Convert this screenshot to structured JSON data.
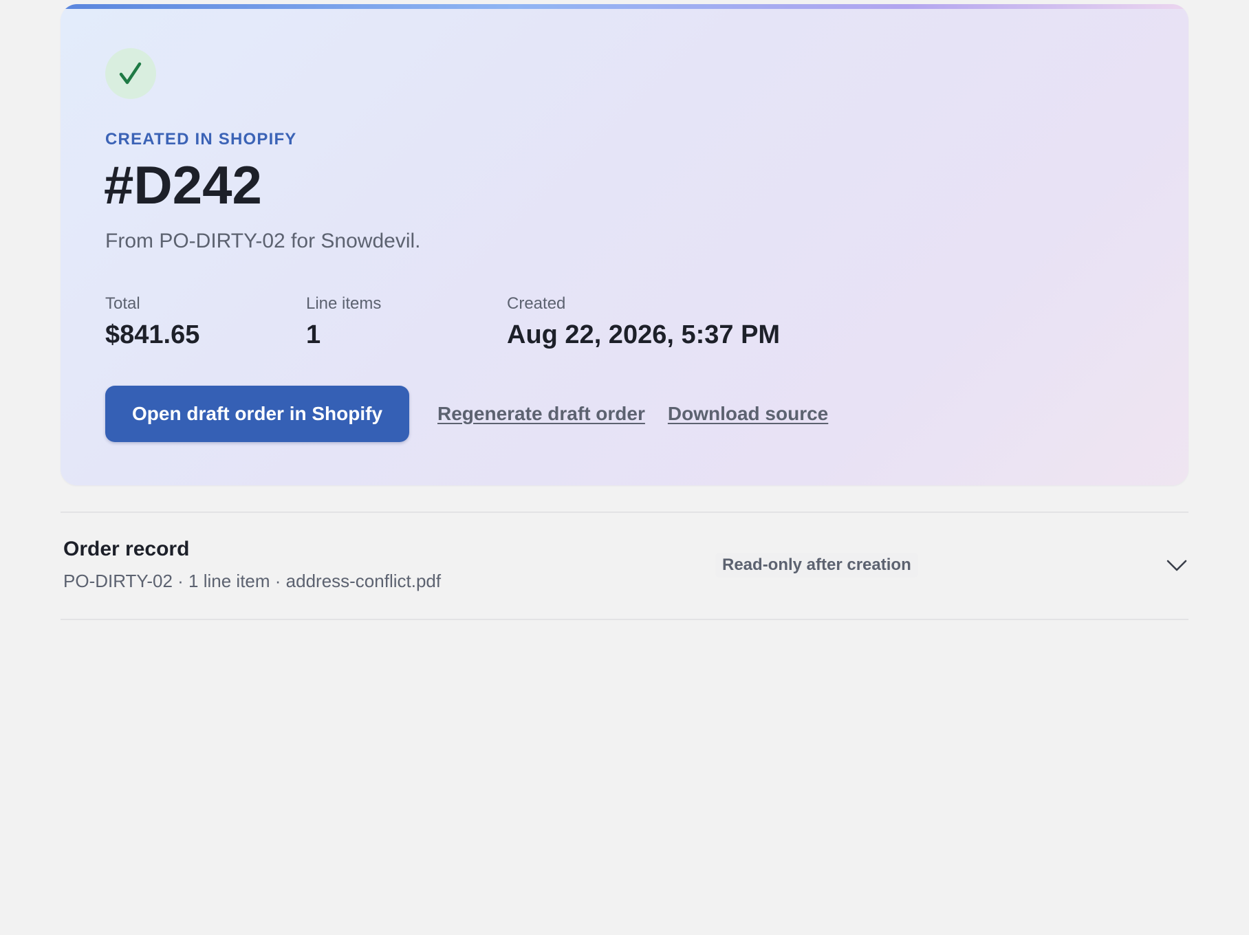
{
  "hero": {
    "status_icon": "checkmark-icon",
    "eyebrow": "CREATED IN SHOPIFY",
    "order_number": "#D242",
    "subtitle": "From PO-DIRTY-02 for Snowdevil.",
    "stats": {
      "total_label": "Total",
      "total_value": "$841.65",
      "line_items_label": "Line items",
      "line_items_value": "1",
      "created_label": "Created",
      "created_value": "Aug 22, 2026, 5:37 PM"
    },
    "actions": {
      "primary_label": "Open draft order in Shopify",
      "regenerate_label": "Regenerate draft order",
      "download_label": "Download source"
    }
  },
  "order_record": {
    "title": "Order record",
    "meta": "PO-DIRTY-02 · 1 line item · address-conflict.pdf",
    "badge": "Read-only after creation",
    "toggle_icon": "chevron-down-icon"
  },
  "colors": {
    "accent": "#3560b5",
    "eyebrow": "#3b63b6",
    "success": "#1f7a45",
    "success_bg": "#d9eedf",
    "background": "#f2f2f2"
  }
}
